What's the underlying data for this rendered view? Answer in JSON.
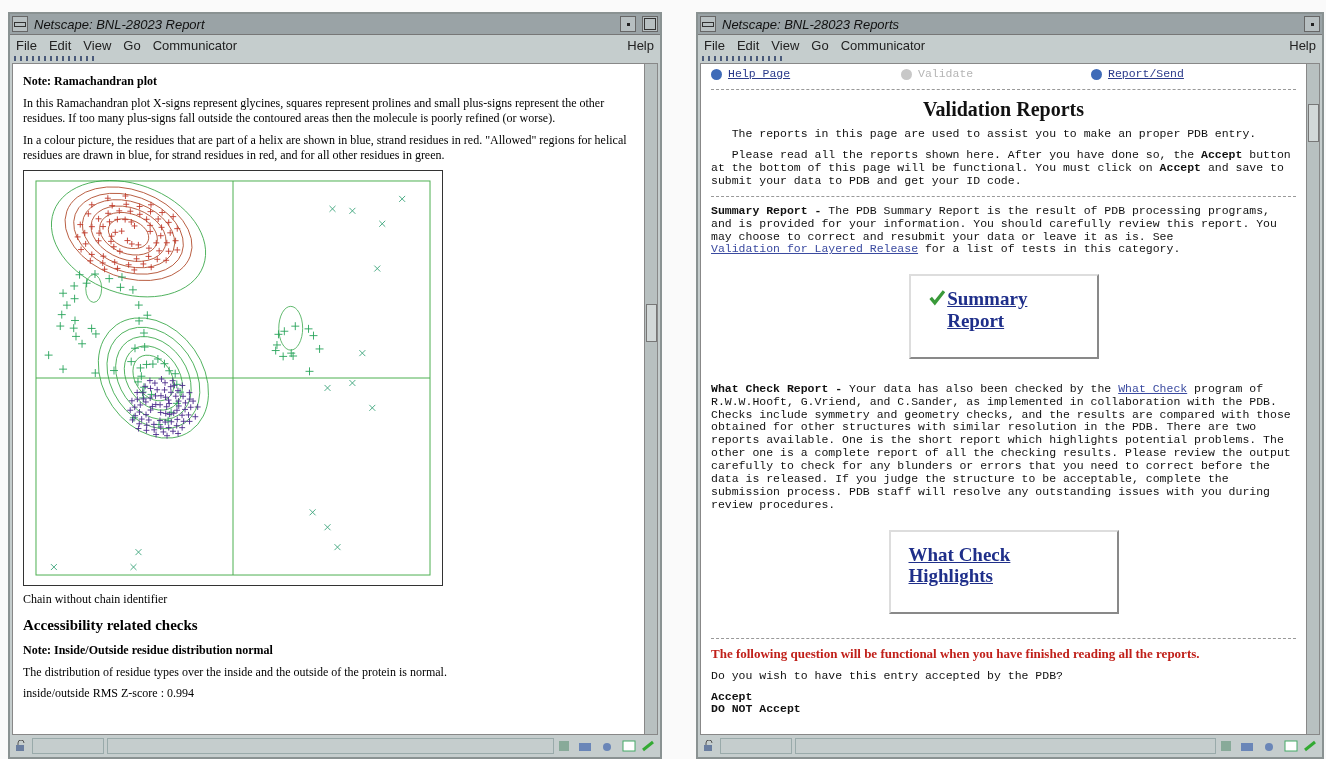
{
  "left_window": {
    "title": "Netscape: BNL-28023 Report",
    "menus": [
      "File",
      "Edit",
      "View",
      "Go",
      "Communicator"
    ],
    "help": "Help",
    "note_title": "Note: Ramachandran plot",
    "paragraphs": [
      "In this Ramachandran plot X-signs represent glycines, squares represent prolines and small plus-signs represent the other residues. If too many plus-signs fall outside the contoured areas then the molecule is poorly refined (or worse).",
      "In a colour picture, the residues that are part of a helix are shown in blue, strand residues in red. \"Allowed\" regions for helical residues are drawn in blue, for strand residues in red, and for all other residues in green."
    ],
    "caption": "Chain without chain identifier",
    "section_heading": "Accessibility related checks",
    "note2_title": "Note: Inside/Outside residue distribution normal",
    "note2_text": "The distribution of residue types over the inside and the outside of the protein is normal.",
    "score": "inside/outside RMS Z-score : 0.994"
  },
  "right_window": {
    "title": "Netscape: BNL-28023 Reports",
    "menus": [
      "File",
      "Edit",
      "View",
      "Go",
      "Communicator"
    ],
    "help": "Help",
    "nav": [
      {
        "label": "Help Page",
        "disabled": false
      },
      {
        "label": "Validate",
        "disabled": true
      },
      {
        "label": "Report/Send",
        "disabled": false
      }
    ],
    "heading": "Validation Reports",
    "intro": [
      "The reports in this page are used to assist you to make an proper PDB entry.",
      "Please read all the reports shown here.  After you have done so, the **Accept** button at the bottom of this page will be functional.  You must click on **Accept** and save to submit your data to PDB and get your ID code."
    ],
    "summary": {
      "lead": "Summary Report -",
      "text": "The PDB Summary Report is the result of PDB processing programs, and is provided for your information. You should carefully review this report. You may choose to correct and resubmit your data or leave it as is. See",
      "link": "Validation for Layered Release",
      "after": "for a list of tests in this category.",
      "button": "Summary Report"
    },
    "whatcheck": {
      "lead": "What Check Report -",
      "text": "Your data has also been checked by the",
      "link": "What Check",
      "after": "program of R.W.W.Hooft, G.Vriend, and C.Sander, as implemented in collaboration with the PDB. Checks include symmetry and geometry checks, and the results are compared with those obtained for other structures with similar resolution in the PDB. There are two reports available. One is the short report which highlights potential problems. The other one is a complete report of all the checking results. Please review the output carefully to check for any blunders or errors that you need to correct before the data is released. If you judge the structure to be acceptable, complete the submission process. PDB staff will resolve any outstanding issues with you during review procedures.",
      "button": "What Check Highlights"
    },
    "warning": "The following question will be functional when you have finished reading all the reports.",
    "question": "Do you wish to have this entry accepted by the PDB?",
    "options": [
      "Accept",
      "DO NOT Accept"
    ]
  }
}
